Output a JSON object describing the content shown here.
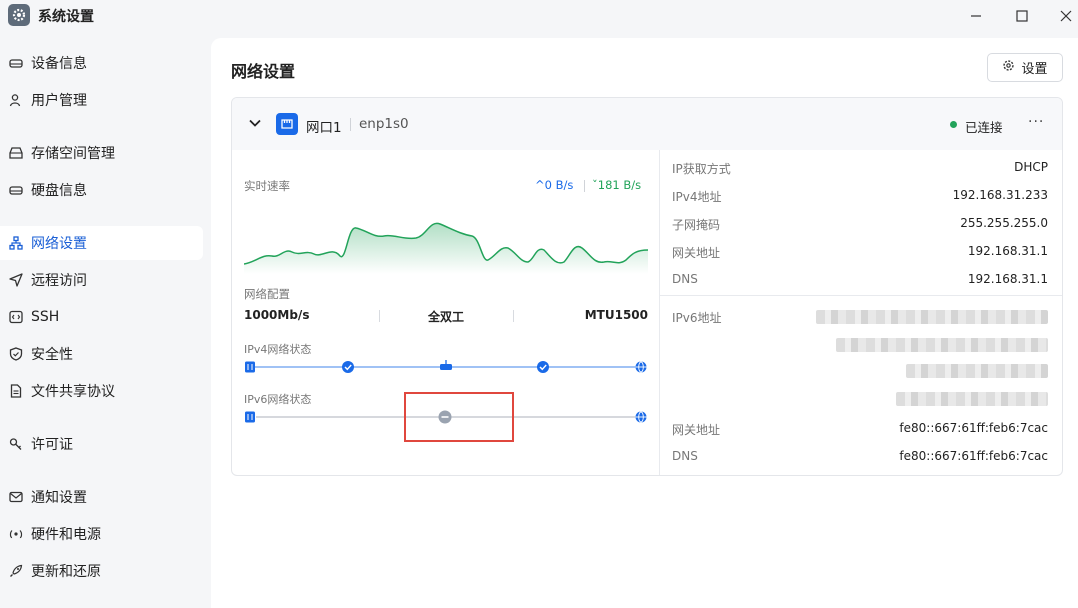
{
  "window": {
    "title": "系统设置"
  },
  "sidebar": {
    "items": [
      {
        "label": "设备信息",
        "icon": "hard-drive-icon"
      },
      {
        "label": "用户管理",
        "icon": "user-icon"
      },
      {
        "label": "存储空间管理",
        "icon": "storage-icon"
      },
      {
        "label": "硬盘信息",
        "icon": "disk-icon"
      },
      {
        "label": "网络设置",
        "icon": "network-icon",
        "active": true
      },
      {
        "label": "远程访问",
        "icon": "send-icon"
      },
      {
        "label": "SSH",
        "icon": "terminal-icon"
      },
      {
        "label": "安全性",
        "icon": "shield-icon"
      },
      {
        "label": "文件共享协议",
        "icon": "file-icon"
      },
      {
        "label": "许可证",
        "icon": "key-icon"
      },
      {
        "label": "通知设置",
        "icon": "mail-icon"
      },
      {
        "label": "硬件和电源",
        "icon": "power-icon"
      },
      {
        "label": "更新和还原",
        "icon": "rocket-icon"
      }
    ]
  },
  "main": {
    "title": "网络设置",
    "settings_button": "设置"
  },
  "port": {
    "name": "网口1",
    "interface": "enp1s0",
    "status": "已连接",
    "more": "···",
    "speed_label": "实时速率",
    "upload": "0 B/s",
    "download": "181 B/s",
    "config_label": "网络配置",
    "link_speed": "1000Mb/s",
    "duplex": "全双工",
    "mtu": "MTU1500",
    "ipv4_status_label": "IPv4网络状态",
    "ipv6_status_label": "IPv6网络状态"
  },
  "ipv4": {
    "method_label": "IP获取方式",
    "method": "DHCP",
    "addr_label": "IPv4地址",
    "addr": "192.168.31.233",
    "mask_label": "子网掩码",
    "mask": "255.255.255.0",
    "gateway_label": "网关地址",
    "gateway": "192.168.31.1",
    "dns_label": "DNS",
    "dns": "192.168.31.1"
  },
  "ipv6": {
    "addr_label": "IPv6地址",
    "gateway_label": "网关地址",
    "gateway": "fe80::667:61ff:feb6:7cac",
    "dns_label": "DNS",
    "dns": "fe80::667:61ff:feb6:7cac"
  },
  "colors": {
    "accent": "#1a6ae8",
    "success": "#22a35a",
    "highlight": "#e0473e"
  }
}
